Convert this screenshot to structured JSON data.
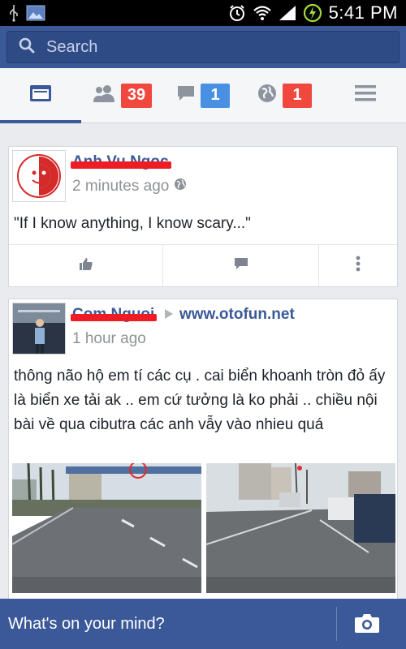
{
  "status_bar": {
    "time": "5:41 PM",
    "icons": [
      "usb-icon",
      "gallery-icon",
      "alarm-icon",
      "wifi-icon",
      "signal-icon",
      "battery-charging-icon"
    ]
  },
  "search": {
    "placeholder": "Search",
    "icon": "search-icon"
  },
  "nav": {
    "tabs": [
      {
        "name": "news-feed",
        "icon": "news-feed-icon",
        "active": true
      },
      {
        "name": "friend-requests",
        "icon": "friends-icon",
        "badge": "39",
        "badge_color": "#f0473f"
      },
      {
        "name": "messages",
        "icon": "chat-bubble-icon",
        "badge": "1",
        "badge_color": "#4a90e2"
      },
      {
        "name": "notifications",
        "icon": "globe-icon",
        "badge": "1",
        "badge_color": "#f0473f"
      },
      {
        "name": "more",
        "icon": "menu-icon"
      }
    ]
  },
  "feed": {
    "posts": [
      {
        "author": "Anh Vu Ngoc",
        "time": "2 minutes ago",
        "text": "\"If I know anything, I know scary...\"",
        "actions": [
          "like-icon",
          "comment-icon",
          "more-icon"
        ]
      },
      {
        "author": "Com Nguoi",
        "time": "1 hour ago",
        "shared_to": "www.otofun.net",
        "text": "thông não hộ em tí các cụ . cai biển khoanh tròn đỏ ấy là biển xe tải ak .. em cứ tưởng là ko phải .. chiều nội bài về qua cibutra các anh vẫy vào nhieu quá",
        "photos": [
          "highway-sign-photo",
          "intersection-photo"
        ]
      }
    ]
  },
  "composer": {
    "placeholder": "What's on your mind?",
    "icon": "camera-icon"
  },
  "colors": {
    "brand": "#3b5998",
    "badge_red": "#f0473f",
    "badge_blue": "#4a90e2",
    "redaction": "#ef1c24"
  }
}
